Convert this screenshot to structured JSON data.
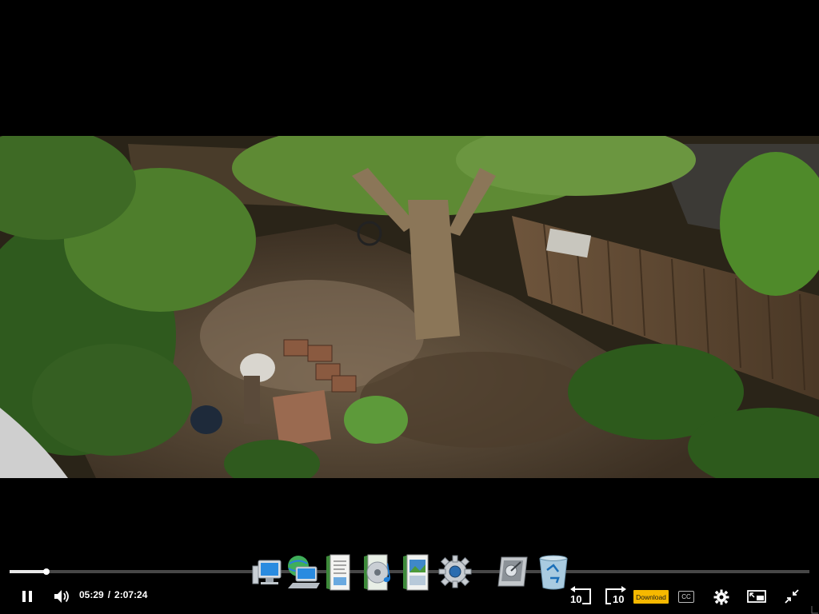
{
  "player": {
    "current_time": "05:29",
    "separator": "/",
    "duration": "2:07:24",
    "progress_fraction": 0.046,
    "state": "playing",
    "skip_back_seconds": "10",
    "skip_forward_seconds": "10",
    "download_label": "Download",
    "cc_label": "CC"
  },
  "controls": [
    {
      "name": "pause-button",
      "icon": "pause-icon"
    },
    {
      "name": "volume-button",
      "icon": "speaker-icon"
    },
    {
      "name": "rewind-10-button",
      "icon": "rewind-icon"
    },
    {
      "name": "forward-10-button",
      "icon": "forward-icon"
    },
    {
      "name": "download-button",
      "icon": "download-badge"
    },
    {
      "name": "captions-button",
      "icon": "cc-icon"
    },
    {
      "name": "settings-button",
      "icon": "gear-icon"
    },
    {
      "name": "picture-in-picture-button",
      "icon": "pip-icon"
    },
    {
      "name": "exit-fullscreen-button",
      "icon": "collapse-icon"
    }
  ],
  "dock": [
    {
      "name": "dock-computer-icon"
    },
    {
      "name": "dock-network-icon"
    },
    {
      "name": "dock-documents-icon"
    },
    {
      "name": "dock-music-icon"
    },
    {
      "name": "dock-pictures-icon"
    },
    {
      "name": "dock-settings-icon"
    },
    {
      "name": "dock-control-panel-icon"
    },
    {
      "name": "dock-recycle-bin-icon"
    }
  ],
  "colors": {
    "background": "#000000",
    "download_badge": "#f6b800",
    "progress_played": "#e8e8e8"
  }
}
